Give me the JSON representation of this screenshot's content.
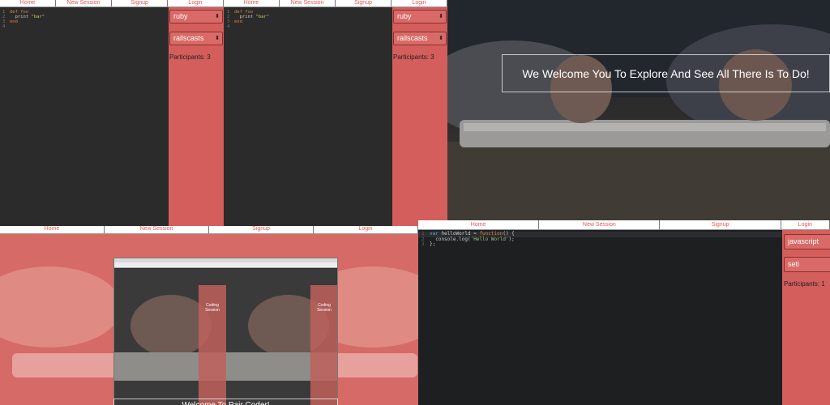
{
  "nav": {
    "home": "Home",
    "new_session": "New Session",
    "signup": "Signup",
    "login": "Login"
  },
  "ruby_code": {
    "line1_num": "1",
    "line1_kw": "def",
    "line1_rest": " foo",
    "line2_num": "2",
    "line2_code": "  print ",
    "line2_str": "\"bar\"",
    "line3_num": "3",
    "line3_kw": "end",
    "line4_num": "4"
  },
  "left_sidebar": {
    "language": "ruby",
    "theme": "railscasts",
    "participants": "Participants: 3"
  },
  "welcome_text": "We Welcome You To Explore And See All There Is To Do!",
  "bottom_welcome": "Welcome To Pair Coder!",
  "js_code": {
    "line1_num": "1",
    "line1_var": "var",
    "line1_name": " helloWorld",
    "line1_eq": " = ",
    "line1_fn": "function",
    "line1_end": "() {",
    "line2_num": "2",
    "line2_code": "  console.log(",
    "line2_str": "'Hello World'",
    "line2_end": ");",
    "line3_num": "3",
    "line3_code": "};"
  },
  "right_sidebar": {
    "language": "javascript",
    "theme": "seti",
    "participants": "Participants: 1"
  },
  "mini": {
    "coding_label": "Coding Session"
  },
  "colors": {
    "accent": "#d45e5b",
    "editor": "#2b2b2b"
  }
}
